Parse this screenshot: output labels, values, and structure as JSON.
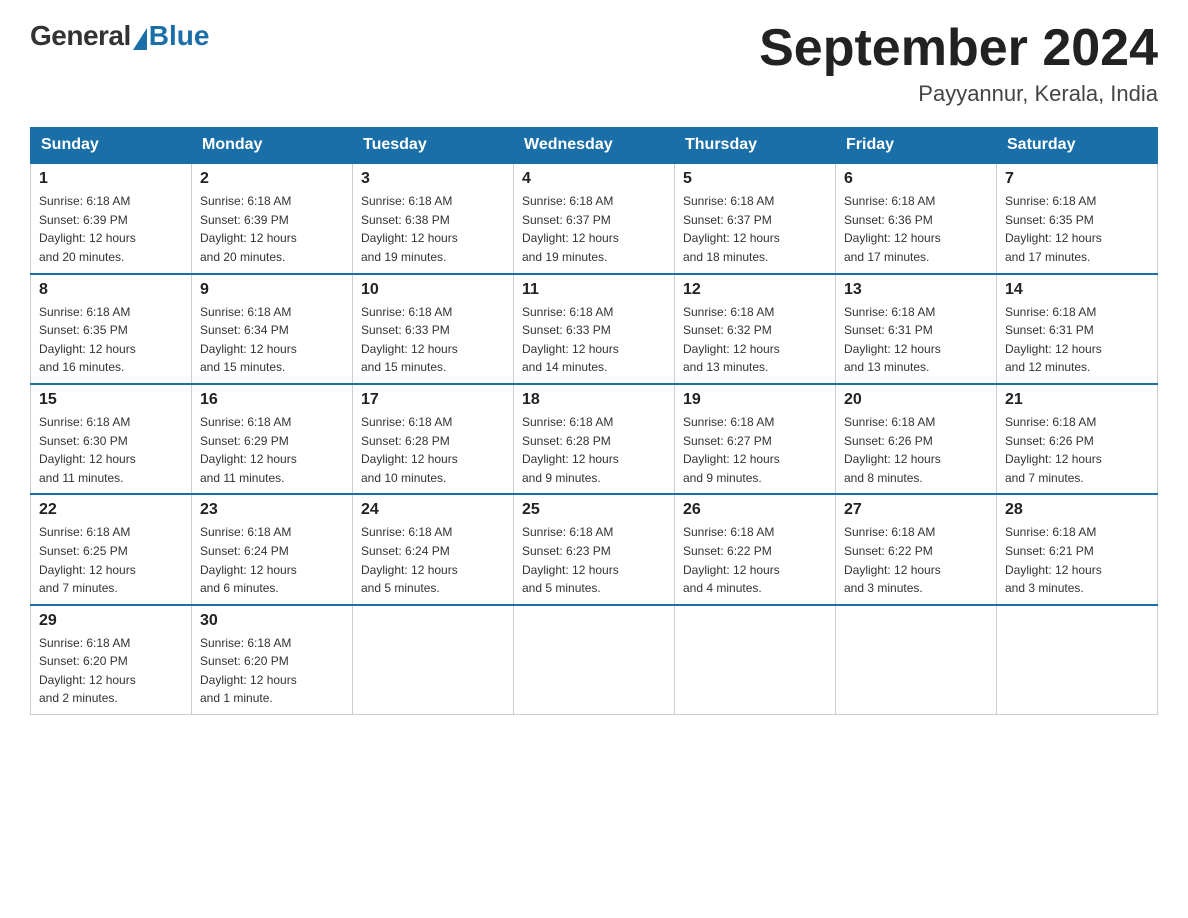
{
  "logo": {
    "general": "General",
    "blue": "Blue"
  },
  "title": "September 2024",
  "location": "Payyannur, Kerala, India",
  "headers": [
    "Sunday",
    "Monday",
    "Tuesday",
    "Wednesday",
    "Thursday",
    "Friday",
    "Saturday"
  ],
  "weeks": [
    [
      {
        "day": "1",
        "sunrise": "6:18 AM",
        "sunset": "6:39 PM",
        "daylight": "12 hours and 20 minutes."
      },
      {
        "day": "2",
        "sunrise": "6:18 AM",
        "sunset": "6:39 PM",
        "daylight": "12 hours and 20 minutes."
      },
      {
        "day": "3",
        "sunrise": "6:18 AM",
        "sunset": "6:38 PM",
        "daylight": "12 hours and 19 minutes."
      },
      {
        "day": "4",
        "sunrise": "6:18 AM",
        "sunset": "6:37 PM",
        "daylight": "12 hours and 19 minutes."
      },
      {
        "day": "5",
        "sunrise": "6:18 AM",
        "sunset": "6:37 PM",
        "daylight": "12 hours and 18 minutes."
      },
      {
        "day": "6",
        "sunrise": "6:18 AM",
        "sunset": "6:36 PM",
        "daylight": "12 hours and 17 minutes."
      },
      {
        "day": "7",
        "sunrise": "6:18 AM",
        "sunset": "6:35 PM",
        "daylight": "12 hours and 17 minutes."
      }
    ],
    [
      {
        "day": "8",
        "sunrise": "6:18 AM",
        "sunset": "6:35 PM",
        "daylight": "12 hours and 16 minutes."
      },
      {
        "day": "9",
        "sunrise": "6:18 AM",
        "sunset": "6:34 PM",
        "daylight": "12 hours and 15 minutes."
      },
      {
        "day": "10",
        "sunrise": "6:18 AM",
        "sunset": "6:33 PM",
        "daylight": "12 hours and 15 minutes."
      },
      {
        "day": "11",
        "sunrise": "6:18 AM",
        "sunset": "6:33 PM",
        "daylight": "12 hours and 14 minutes."
      },
      {
        "day": "12",
        "sunrise": "6:18 AM",
        "sunset": "6:32 PM",
        "daylight": "12 hours and 13 minutes."
      },
      {
        "day": "13",
        "sunrise": "6:18 AM",
        "sunset": "6:31 PM",
        "daylight": "12 hours and 13 minutes."
      },
      {
        "day": "14",
        "sunrise": "6:18 AM",
        "sunset": "6:31 PM",
        "daylight": "12 hours and 12 minutes."
      }
    ],
    [
      {
        "day": "15",
        "sunrise": "6:18 AM",
        "sunset": "6:30 PM",
        "daylight": "12 hours and 11 minutes."
      },
      {
        "day": "16",
        "sunrise": "6:18 AM",
        "sunset": "6:29 PM",
        "daylight": "12 hours and 11 minutes."
      },
      {
        "day": "17",
        "sunrise": "6:18 AM",
        "sunset": "6:28 PM",
        "daylight": "12 hours and 10 minutes."
      },
      {
        "day": "18",
        "sunrise": "6:18 AM",
        "sunset": "6:28 PM",
        "daylight": "12 hours and 9 minutes."
      },
      {
        "day": "19",
        "sunrise": "6:18 AM",
        "sunset": "6:27 PM",
        "daylight": "12 hours and 9 minutes."
      },
      {
        "day": "20",
        "sunrise": "6:18 AM",
        "sunset": "6:26 PM",
        "daylight": "12 hours and 8 minutes."
      },
      {
        "day": "21",
        "sunrise": "6:18 AM",
        "sunset": "6:26 PM",
        "daylight": "12 hours and 7 minutes."
      }
    ],
    [
      {
        "day": "22",
        "sunrise": "6:18 AM",
        "sunset": "6:25 PM",
        "daylight": "12 hours and 7 minutes."
      },
      {
        "day": "23",
        "sunrise": "6:18 AM",
        "sunset": "6:24 PM",
        "daylight": "12 hours and 6 minutes."
      },
      {
        "day": "24",
        "sunrise": "6:18 AM",
        "sunset": "6:24 PM",
        "daylight": "12 hours and 5 minutes."
      },
      {
        "day": "25",
        "sunrise": "6:18 AM",
        "sunset": "6:23 PM",
        "daylight": "12 hours and 5 minutes."
      },
      {
        "day": "26",
        "sunrise": "6:18 AM",
        "sunset": "6:22 PM",
        "daylight": "12 hours and 4 minutes."
      },
      {
        "day": "27",
        "sunrise": "6:18 AM",
        "sunset": "6:22 PM",
        "daylight": "12 hours and 3 minutes."
      },
      {
        "day": "28",
        "sunrise": "6:18 AM",
        "sunset": "6:21 PM",
        "daylight": "12 hours and 3 minutes."
      }
    ],
    [
      {
        "day": "29",
        "sunrise": "6:18 AM",
        "sunset": "6:20 PM",
        "daylight": "12 hours and 2 minutes."
      },
      {
        "day": "30",
        "sunrise": "6:18 AM",
        "sunset": "6:20 PM",
        "daylight": "12 hours and 1 minute."
      },
      null,
      null,
      null,
      null,
      null
    ]
  ]
}
